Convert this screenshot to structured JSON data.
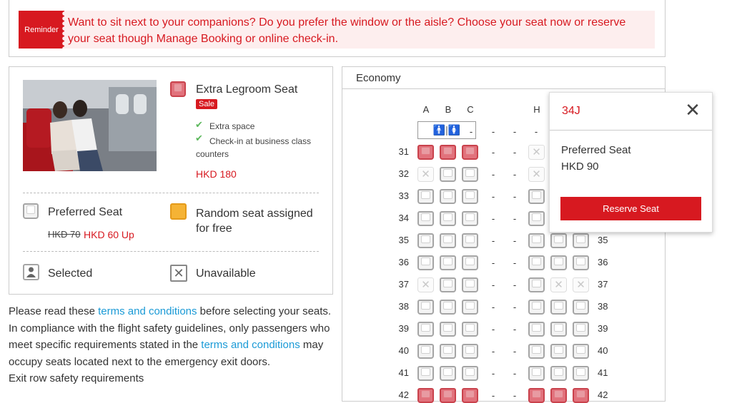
{
  "reminder": {
    "tag": "Reminder",
    "text": "Want to sit next to your companions? Do you prefer the window or the aisle? Choose your seat now or reserve your seat though Manage Booking or online check-in."
  },
  "legend": {
    "extra_legroom": {
      "title": "Extra Legroom Seat",
      "badge": "Sale",
      "features": [
        "Extra space",
        "Check-in at business class counters"
      ],
      "price": "HKD 180"
    },
    "preferred": {
      "title": "Preferred Seat",
      "old_price": "HKD 70",
      "price": "HKD 60 Up"
    },
    "random": {
      "title": "Random seat assigned for free"
    },
    "selected": {
      "title": "Selected"
    },
    "unavailable": {
      "title": "Unavailable"
    }
  },
  "info": {
    "part1": "Please read these ",
    "link1": "terms and conditions",
    "part2": " before selecting your seats. In compliance with the flight safety guidelines, only passengers who meet specific requirements stated in the ",
    "link2": "terms and conditions",
    "part3": " may occupy seats located next to the emergency exit doors.",
    "part4": "Exit row safety requirements"
  },
  "map": {
    "cabin": "Economy",
    "left_columns": [
      "A",
      "B",
      "C"
    ],
    "right_column_visible": "H",
    "aisle_mark": "-",
    "rows": [
      "31",
      "32",
      "33",
      "34",
      "35",
      "36",
      "37",
      "38",
      "39",
      "40",
      "41",
      "42"
    ]
  },
  "popup": {
    "seat": "34J",
    "type": "Preferred Seat",
    "price": "HKD 90",
    "button": "Reserve Seat"
  },
  "colors": {
    "accent": "#d71920",
    "link": "#1a9ad6",
    "extra_legroom_seat": "#e1727c",
    "random_seat": "#f5b335"
  }
}
